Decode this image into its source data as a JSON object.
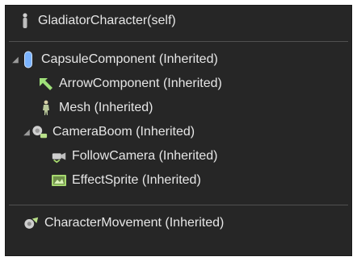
{
  "header": {
    "label": "GladiatorCharacter(self)"
  },
  "components": [
    {
      "label": "CapsuleComponent (Inherited)",
      "icon": "capsule-icon",
      "expandable": true,
      "expanded": true
    },
    {
      "label": "ArrowComponent (Inherited)",
      "icon": "arrow-icon"
    },
    {
      "label": "Mesh (Inherited)",
      "icon": "mesh-icon"
    },
    {
      "label": "CameraBoom (Inherited)",
      "icon": "camera-boom-icon",
      "expandable": true,
      "expanded": true
    },
    {
      "label": "FollowCamera (Inherited)",
      "icon": "camera-icon"
    },
    {
      "label": "EffectSprite (Inherited)",
      "icon": "sprite-icon"
    }
  ],
  "footer": {
    "label": "CharacterMovement (Inherited)",
    "icon": "movement-icon"
  },
  "colors": {
    "panel_bg": "#262626",
    "text": "#e6e6e6",
    "capsule_blue": "#7ab3ff",
    "arrow_green": "#9fe07a"
  }
}
